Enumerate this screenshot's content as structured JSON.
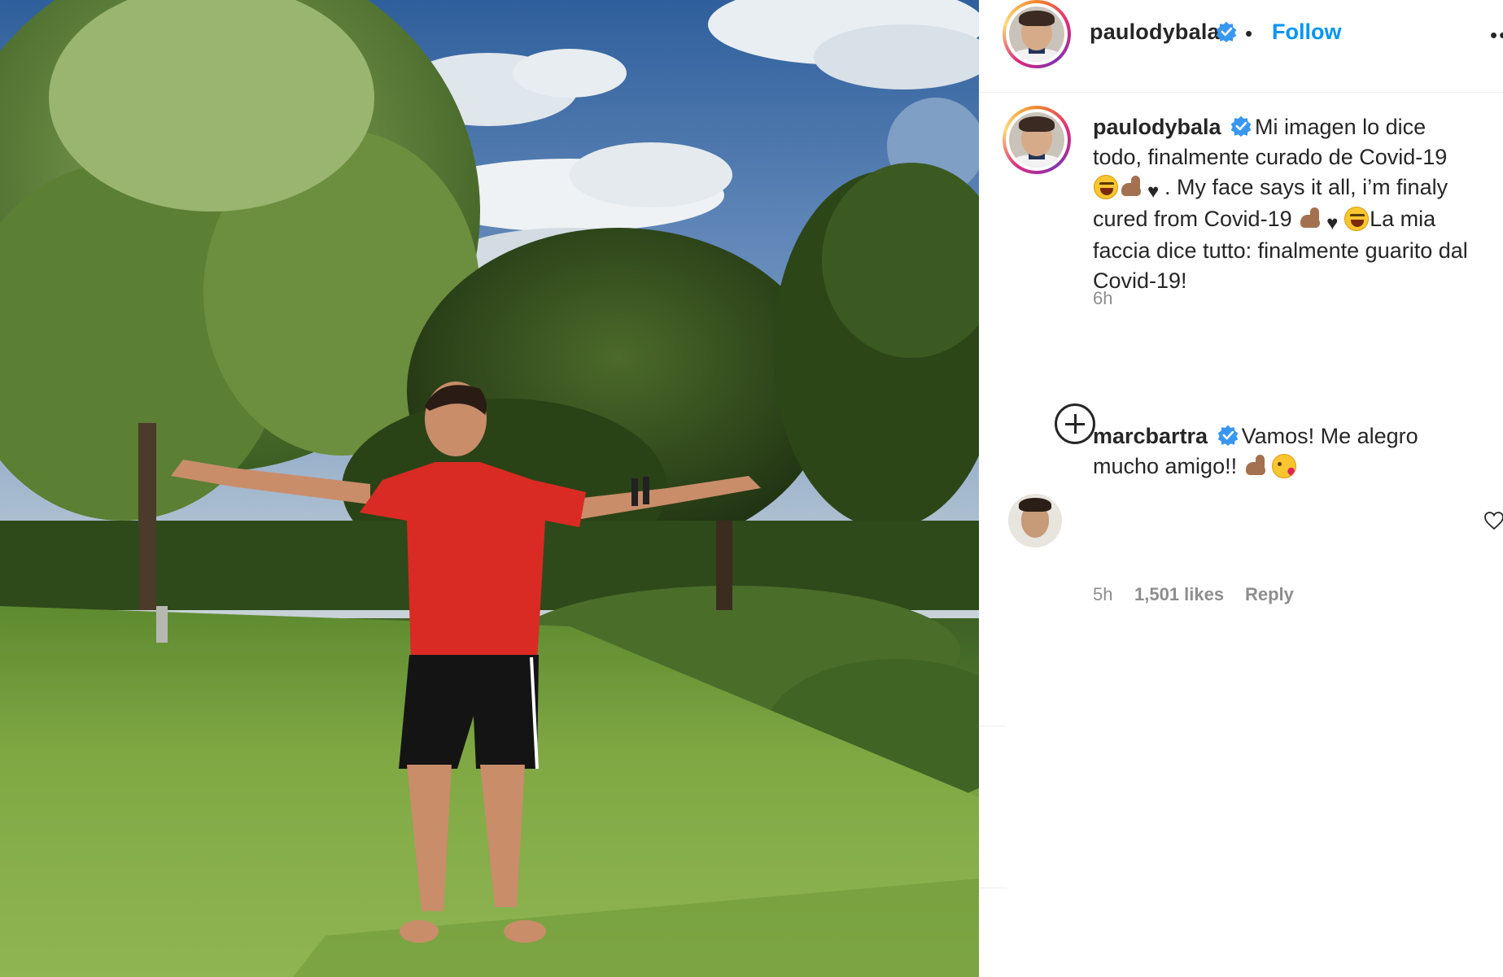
{
  "post": {
    "image_alt": "Man in red t-shirt and black shorts with arms outstretched on a lawn under a blue sky",
    "colors": {
      "sky": "#3f6fa8",
      "grass": "#8cb44c",
      "shirt": "#d92b23"
    }
  },
  "header": {
    "username": "paulodybala",
    "separator": "•",
    "follow_label": "Follow",
    "more_label": "••"
  },
  "caption": {
    "username": "paulodybala",
    "text_1": "Mi imagen lo dice",
    "text_2": "todo, finalmente curado de Covid-19",
    "text_3": ". My face says it all, i’m finaly",
    "text_4": "cured from Covid-19",
    "text_5": "La mia",
    "text_6": "faccia dice tutto: finalmente guarito dal",
    "text_7": "Covid-19!",
    "time": "6h"
  },
  "comments": [
    {
      "username": "marcbartra",
      "text_1": "Vamos! Me alegro",
      "text_2": "mucho amigo!!",
      "time": "5h",
      "likes": "1,501 likes",
      "reply_label": "Reply"
    }
  ],
  "icons": {
    "verified": "verified-badge-icon",
    "load_more": "plus-circle-icon",
    "like": "heart-outline-icon"
  },
  "accent_color": "#0095f6"
}
